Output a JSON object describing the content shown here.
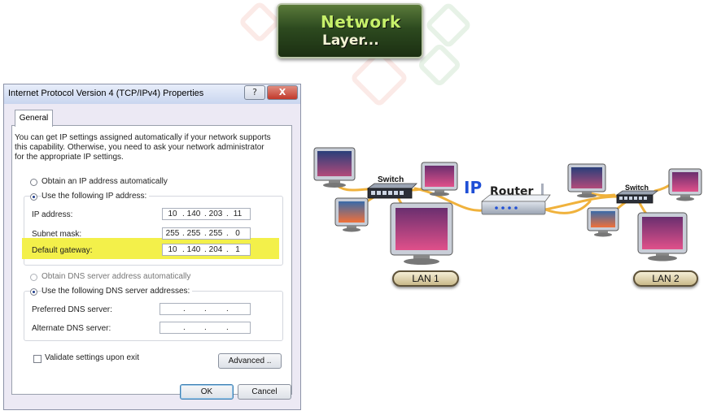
{
  "badge": {
    "line1": "Network",
    "line2": "Layer..."
  },
  "dialog": {
    "title": "Internet Protocol Version 4 (TCP/IPv4) Properties",
    "help_label": "?",
    "close_label": "X",
    "tab_label": "General",
    "info_text": "You can get IP settings assigned automatically if your network supports this capability. Otherwise, you need to ask your network administrator for the appropriate IP settings.",
    "ip_auto_label": "Obtain an IP address automatically",
    "ip_manual_label": "Use the following IP address:",
    "ip_address_label": "IP address:",
    "subnet_label": "Subnet mask:",
    "gateway_label": "Default gateway:",
    "ip_address": [
      "10",
      "140",
      "203",
      "11"
    ],
    "subnet_mask": [
      "255",
      "255",
      "255",
      "0"
    ],
    "default_gateway": [
      "10",
      "140",
      "204",
      "1"
    ],
    "dns_auto_label": "Obtain DNS server address automatically",
    "dns_manual_label": "Use the following DNS server addresses:",
    "preferred_dns_label": "Preferred DNS server:",
    "alternate_dns_label": "Alternate DNS server:",
    "validate_label": "Validate settings upon exit",
    "advanced_label": "Advanced ..",
    "ok_label": "OK",
    "cancel_label": "Cancel",
    "selected_ip_mode": "manual",
    "selected_dns_mode": "manual",
    "validate_checked": false
  },
  "diagram": {
    "ip_label": "IP",
    "router_label": "Router",
    "switch1_label": "Switch",
    "switch2_label": "Switch",
    "lan1_label": "LAN 1",
    "lan2_label": "LAN 2",
    "cable_color": "#f0b23c"
  },
  "colors": {
    "highlight": "#f3f04a",
    "ip_text": "#1f4fd6",
    "badge_text": "#c6f06a"
  }
}
